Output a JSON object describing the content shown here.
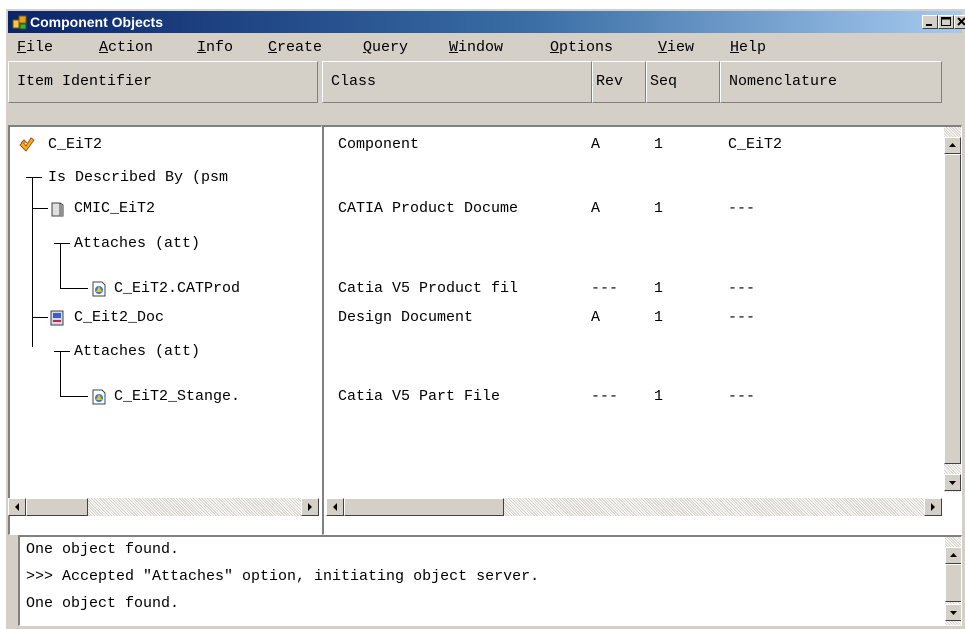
{
  "window": {
    "title": "Component Objects",
    "app_icon": "component-objects-icon",
    "controls": [
      "minimize-icon",
      "maximize-icon",
      "close-icon"
    ]
  },
  "menu": {
    "items": [
      "File",
      "Action",
      "Info",
      "Create",
      "Query",
      "Window",
      "Options",
      "View",
      "Help"
    ]
  },
  "left_header": "Item Identifier",
  "columns": [
    "Class",
    "Rev",
    "Seq",
    "Nomenclature"
  ],
  "tree": [
    {
      "label": "C_EiT2",
      "icon": "component-icon"
    },
    {
      "label": "Is Described By (psm",
      "icon": ""
    },
    {
      "label": "CMIC_EiT2",
      "icon": "document-icon"
    },
    {
      "label": "Attaches (att)",
      "icon": ""
    },
    {
      "label": "C_EiT2.CATProd",
      "icon": "catia-file-icon"
    },
    {
      "label": "C_Eit2_Doc",
      "icon": "design-document-icon"
    },
    {
      "label": "Attaches (att)",
      "icon": ""
    },
    {
      "label": "C_EiT2_Stange.",
      "icon": "catia-file-icon"
    }
  ],
  "rows": [
    {
      "class": "Component",
      "rev": "A",
      "seq": "1",
      "nomenclature": "C_EiT2"
    },
    {
      "class": "",
      "rev": "",
      "seq": "",
      "nomenclature": ""
    },
    {
      "class": "CATIA Product Docume",
      "rev": "A",
      "seq": "1",
      "nomenclature": "---"
    },
    {
      "class": "",
      "rev": "",
      "seq": "",
      "nomenclature": ""
    },
    {
      "class": "Catia V5 Product fil",
      "rev": "---",
      "seq": "1",
      "nomenclature": "---"
    },
    {
      "class": "Design Document",
      "rev": "A",
      "seq": "1",
      "nomenclature": "---"
    },
    {
      "class": "",
      "rev": "",
      "seq": "",
      "nomenclature": ""
    },
    {
      "class": "Catia V5 Part File",
      "rev": "---",
      "seq": "1",
      "nomenclature": "---"
    }
  ],
  "messages": [
    "One object found.",
    ">>> Accepted \"Attaches\" option, initiating object server.",
    "One object found."
  ],
  "colors": {
    "titlebar_start": "#0a246a",
    "titlebar_end": "#a6caf0",
    "face": "#d4d0c8"
  }
}
